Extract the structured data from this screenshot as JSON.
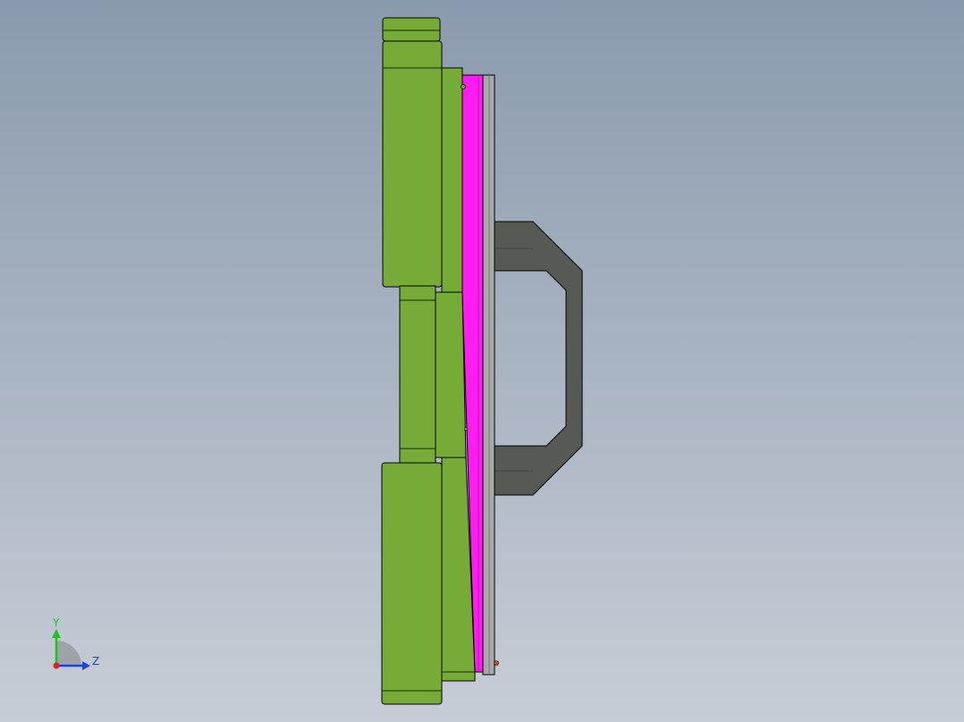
{
  "viewport": {
    "background_top": "#8a9aad",
    "background_bottom": "#c6cdd6"
  },
  "model": {
    "colors": {
      "green_body": "#77ab37",
      "green_dark_edge": "#1a2a0a",
      "magenta_plate": "#ff1cf0",
      "gray_plate": "#a8a8a8",
      "handle": "#575955",
      "edge": "#000000"
    }
  },
  "triad": {
    "y_label": "Y",
    "z_label": "Z",
    "y_color": "#1fc21f",
    "z_color": "#1f3fe0",
    "x_color": "#e01f1f"
  }
}
